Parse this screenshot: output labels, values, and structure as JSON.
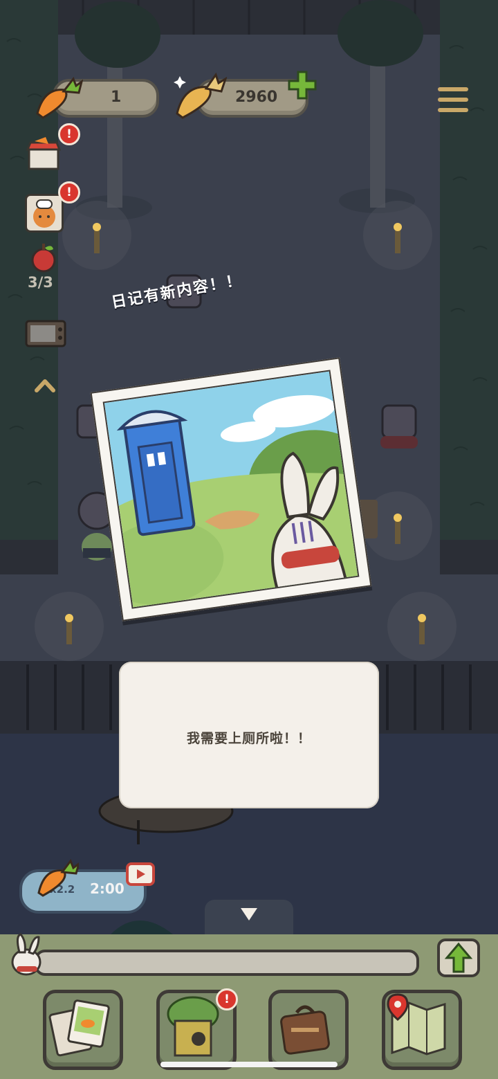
{
  "hud": {
    "carrot_count": "1",
    "gold_carrot_count": "2960",
    "side_counter": "3/3"
  },
  "diary_notice": "日记有新内容！！",
  "dialog": {
    "message": "我需要上厕所啦！！"
  },
  "boost": {
    "multiplier": "x2.2",
    "timer": "2:00"
  },
  "badges": {
    "alert": "!"
  },
  "icons": {
    "carrot": "carrot-icon",
    "gold_carrot": "gold-carrot-icon",
    "add": "plus-icon",
    "menu": "hamburger-menu-icon",
    "shop": "shop-stall-icon",
    "chef": "chef-fox-icon",
    "apple": "apple-icon",
    "tv": "tv-icon",
    "expand": "chevron-up-icon",
    "collapse": "triangle-down-icon",
    "video": "video-ad-icon",
    "upgrade": "green-arrow-up-icon",
    "bunny": "bunny-avatar-icon",
    "photos": "photo-album-icon",
    "tree": "tree-house-icon",
    "suitcase": "suitcase-icon",
    "map": "map-icon"
  },
  "colors": {
    "night_bg": "#2f3444",
    "counter_bg": "#a19a86",
    "badge_red": "#d9362e",
    "add_green": "#76b83a",
    "bottom_bar": "#8e9a74"
  }
}
